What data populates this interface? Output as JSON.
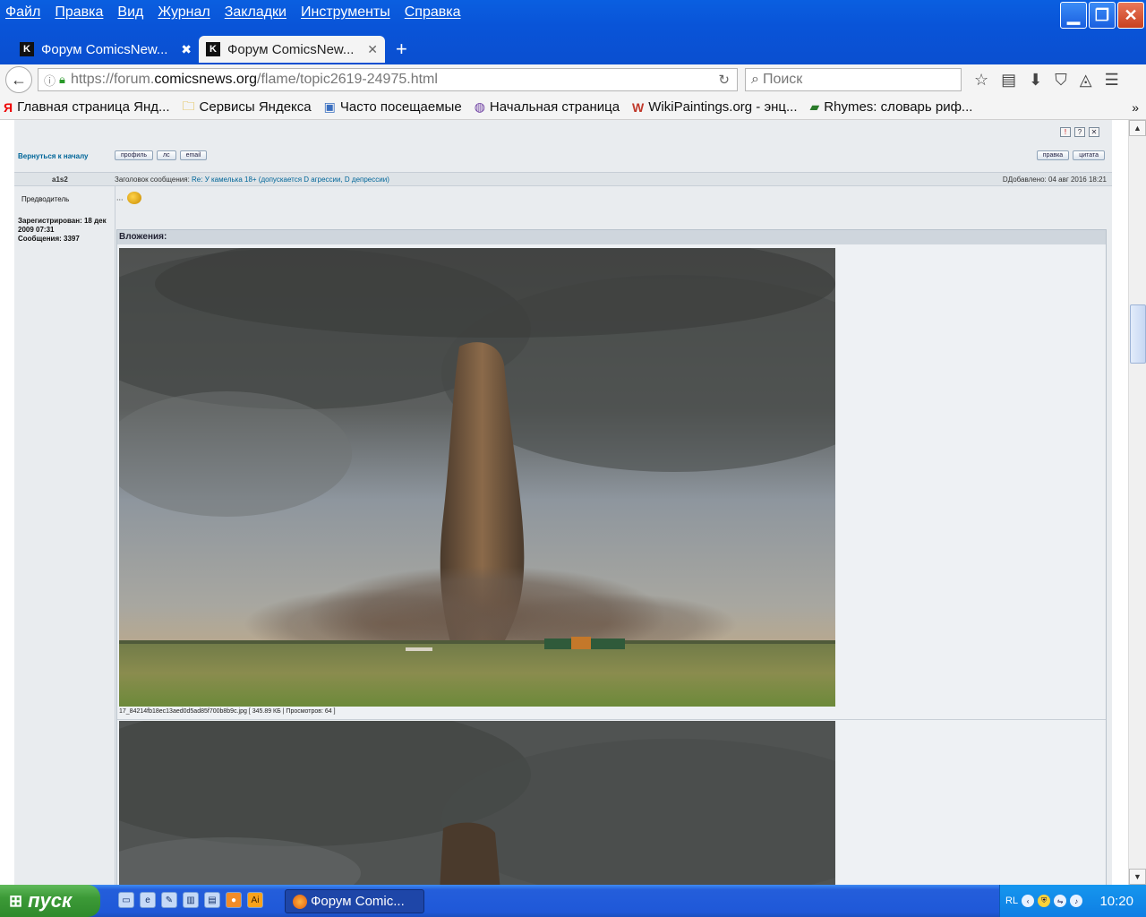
{
  "menu": [
    "Файл",
    "Правка",
    "Вид",
    "Журнал",
    "Закладки",
    "Инструменты",
    "Справка"
  ],
  "tabs": [
    {
      "title": "Форум ComicsNew...",
      "favicon": "K",
      "active": false
    },
    {
      "title": "Форум ComicsNew...",
      "favicon": "K",
      "active": true
    }
  ],
  "url": {
    "scheme": "https://forum.",
    "host": "comicsnews.org",
    "path": "/flame/topic2619-24975.html"
  },
  "search": {
    "placeholder": "Поиск"
  },
  "bookmarks": [
    {
      "label": "Главная страница Янд...",
      "icon": "yandex-icon"
    },
    {
      "label": "Сервисы Яндекса",
      "icon": "folder-icon"
    },
    {
      "label": "Часто посещаемые",
      "icon": "search-folder-icon"
    },
    {
      "label": "Начальная страница",
      "icon": "globe-icon"
    },
    {
      "label": "WikiPaintings.org - энц...",
      "icon": "wikipaintings-icon"
    },
    {
      "label": "Rhymes: словарь риф...",
      "icon": "book-icon"
    }
  ],
  "forum": {
    "back_link": "Вернуться к началу",
    "buttons_left": [
      "профиль",
      "лс",
      "email"
    ],
    "buttons_right": [
      "правка",
      "цитата"
    ],
    "post": {
      "author": "a1s2",
      "subject_label": "Заголовок сообщения:",
      "subject": "Re: У камелька 18+ (допускается D агрессии, D депрессии)",
      "posted": "DДобавлено: 04 авг 2016 18:21",
      "rank": "Предводитель",
      "registered": "Зарегистрирован: 18 дек 2009 07:31",
      "messages": "Сообщения: 3397",
      "body": "..."
    },
    "attachments_label": "Вложения:",
    "attachments": [
      {
        "caption": "17_84214fb18ec13aed0d5ad85f700b8b9c.jpg [ 345.89 КБ | Просмотров: 64 ]"
      }
    ]
  },
  "taskbar": {
    "start": "пуск",
    "item": "Форум Comic...",
    "lang": "RL",
    "clock": "10:20"
  }
}
